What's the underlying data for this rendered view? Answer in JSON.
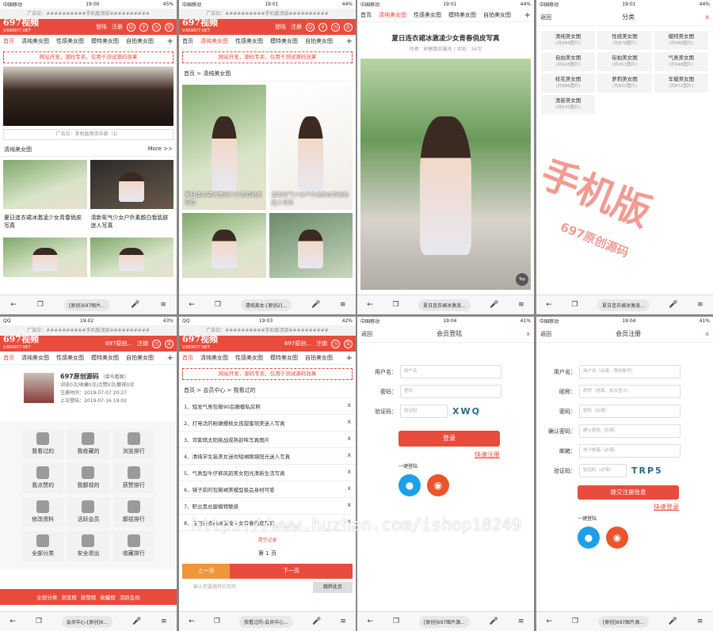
{
  "status": {
    "p1": {
      "carrier": "中国移动",
      "time": "19:00",
      "battery": "45%"
    },
    "p2": {
      "carrier": "中国移动",
      "time": "19:01",
      "battery": "44%"
    },
    "p3": {
      "carrier": "中国移动",
      "time": "19:01",
      "battery": "44%"
    },
    "p4": {
      "carrier": "中国移动",
      "time": "19:01",
      "battery": "44%"
    },
    "p5": {
      "carrier": "QQ",
      "time": "19:02",
      "battery": "43%"
    },
    "p6": {
      "carrier": "QQ",
      "time": "19:03",
      "battery": "42%"
    },
    "p7": {
      "carrier": "中国移动",
      "time": "19:04",
      "battery": "41%"
    },
    "p8": {
      "carrier": "中国移动",
      "time": "19:04",
      "battery": "41%"
    }
  },
  "ad_top": "广告位：##########手机版顶部##########",
  "logo": {
    "name": "697视频",
    "sub": "V.669977.NET"
  },
  "header": {
    "login": "登陆",
    "register": "注册",
    "logout": "注销",
    "user": "697原创..."
  },
  "nav": [
    "首页",
    "清纯美女图",
    "性感美女图",
    "模特美女图",
    "自拍美女图"
  ],
  "nav_plus": "+",
  "notice": "网站开发，源码专卖，仅用于测试源码效果",
  "p1": {
    "ad_mid": "广告位：手机版首页中部（1）",
    "section": "清纯美女图",
    "more": "More >>",
    "items": [
      "夏日连衣裙冰激凌少女青春俏皮写真",
      "清新氧气少女户外素颜白皙肌肤迷人写真"
    ]
  },
  "p2": {
    "crumb": "首页 > 清纯美女图",
    "items": [
      "夏日连衣裙冰激凌少女青春俏皮写真",
      "清新氧气少女户外素颜白皙肌肤迷人写真"
    ]
  },
  "p3": {
    "nav": [
      "首页",
      "清纯美女图",
      "性感美女图",
      "模特美女图",
      "自拍美女图"
    ],
    "title": "夏日连衣裙冰激凌少女青春俏皮写真",
    "meta": "作者：碎碧数的猫天 / 浏览：34次",
    "top": "Top"
  },
  "p4": {
    "back": "返回",
    "title": "分类",
    "close": "x",
    "cats": [
      {
        "name": "清纯美女图",
        "count": "(共984图片)"
      },
      {
        "name": "性感美女图",
        "count": "(共879图片)"
      },
      {
        "name": "模特美女图",
        "count": "(共968图片)"
      },
      {
        "name": "自拍美女图",
        "count": "(共928图片)"
      },
      {
        "name": "街拍美女图",
        "count": "(共951图片)"
      },
      {
        "name": "气质美女图",
        "count": "(共948图片)"
      },
      {
        "name": "校花美女图",
        "count": "(共886图片)"
      },
      {
        "name": "萝莉美女图",
        "count": "(共832图片)"
      },
      {
        "name": "车模美女图",
        "count": "(共872图片)"
      },
      {
        "name": "清新美女图",
        "count": "(共970图片)"
      }
    ],
    "wm1": "手机版",
    "wm2": "697原创源码"
  },
  "p5": {
    "username": "697原创源码",
    "level": "（菜鸟看图）",
    "stats": "浏览0次/收藏0次/点赞0次/鄙视0次",
    "reg": "注册时间：2019-07-07 20:27",
    "last": "上次登陆：2019-07-16 19:02",
    "icons": [
      "我看过的",
      "我收藏的",
      "浏览排行",
      "我点赞的",
      "我鄙视的",
      "获赞排行",
      "修改资料",
      "活跃会员",
      "鄙视排行",
      "全部分类",
      "安全退出",
      "收藏排行"
    ],
    "footer": [
      "全部分类",
      "浏览榜",
      "获赞榜",
      "收藏榜",
      "活跃会员"
    ]
  },
  "p6": {
    "crumb": "首页 > 会员中心 > 我看过的",
    "items": [
      "1、短发气质包臀90后嫩模私房照",
      "2、打电话的粉嫩樱桃女孩甜蜜萌美迷人写真",
      "3、邓紫棋太阳挑战成熟韵味写真图片",
      "4、清纯学生装美女迷你短裙眼镜阳光迷人写真",
      "5、气质型牛仔裤风韵美女阳光清新生活写真",
      "6、镜子前的包臀裙美模型极品身材可爱",
      "7、职业黑丝腿模特魅惑",
      "8、夏日连衣裙冰激凌少女青春俏皮写真"
    ],
    "clear": "清空记录",
    "page": "第 1 页",
    "prev": "上一页",
    "next": "下一页",
    "jump_ph": "输入您要跳转的页码",
    "jump": "跳转此页"
  },
  "p7": {
    "back": "返回",
    "title": "会员登陆",
    "close": "x",
    "user_lab": "用户名：",
    "user_ph": "用户名",
    "pass_lab": "密码：",
    "pass_ph": "密码",
    "cap_lab": "验证码：",
    "cap_ph": "验证码",
    "captcha": "XWQ",
    "submit": "登录",
    "quick": "快速注册",
    "onekey": "一键登陆"
  },
  "p8": {
    "back": "返回",
    "title": "会员注册",
    "close": "x",
    "user_lab": "用户名：",
    "user_ph": "用户名（必填，登陆账号）",
    "nick_lab": "昵称：",
    "nick_ph": "昵称（选填，前台显示）",
    "pass_lab": "密码：",
    "pass_ph": "密码（必填）",
    "pass2_lab": "确认密码：",
    "pass2_ph": "确认密码（必填）",
    "mail_lab": "邮箱：",
    "mail_ph": "电子邮箱（必填）",
    "cap_lab": "验证码：",
    "cap_ph": "验证码（必填）",
    "captcha": "TRP5",
    "submit": "提交注册信息",
    "quick": "快速登录",
    "onekey": "一键登陆"
  },
  "bottom_urls": [
    "[原创]697图片...",
    "清纯美女-[原创2]...",
    "夏日连衣裙冰激凌...",
    "夏日连衣裙冰激凌...",
    "会员中心-[原创]6...",
    "我看过的-会员中心...",
    "[原创]697图片源...",
    "[原创]697图片源..."
  ],
  "watermark_url": "https://www.huzhan.com/ishop18249"
}
